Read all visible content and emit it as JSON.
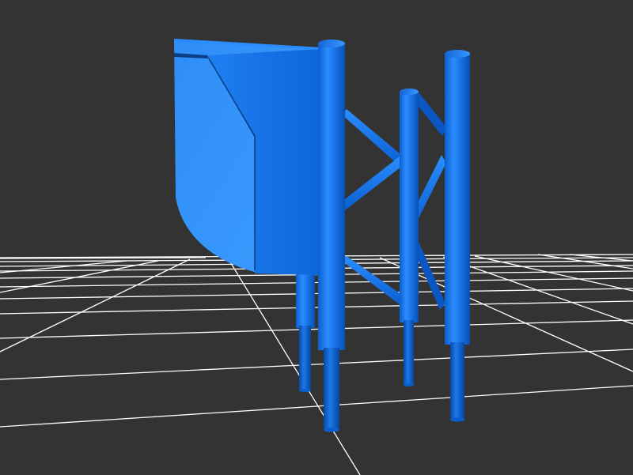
{
  "scene": {
    "background_color": "#333333",
    "grid_color": "#ffffff",
    "model_color": "#1f7ef0",
    "model_highlight_color": "#3a9bff",
    "model_shadow_color": "#0a56b8"
  }
}
